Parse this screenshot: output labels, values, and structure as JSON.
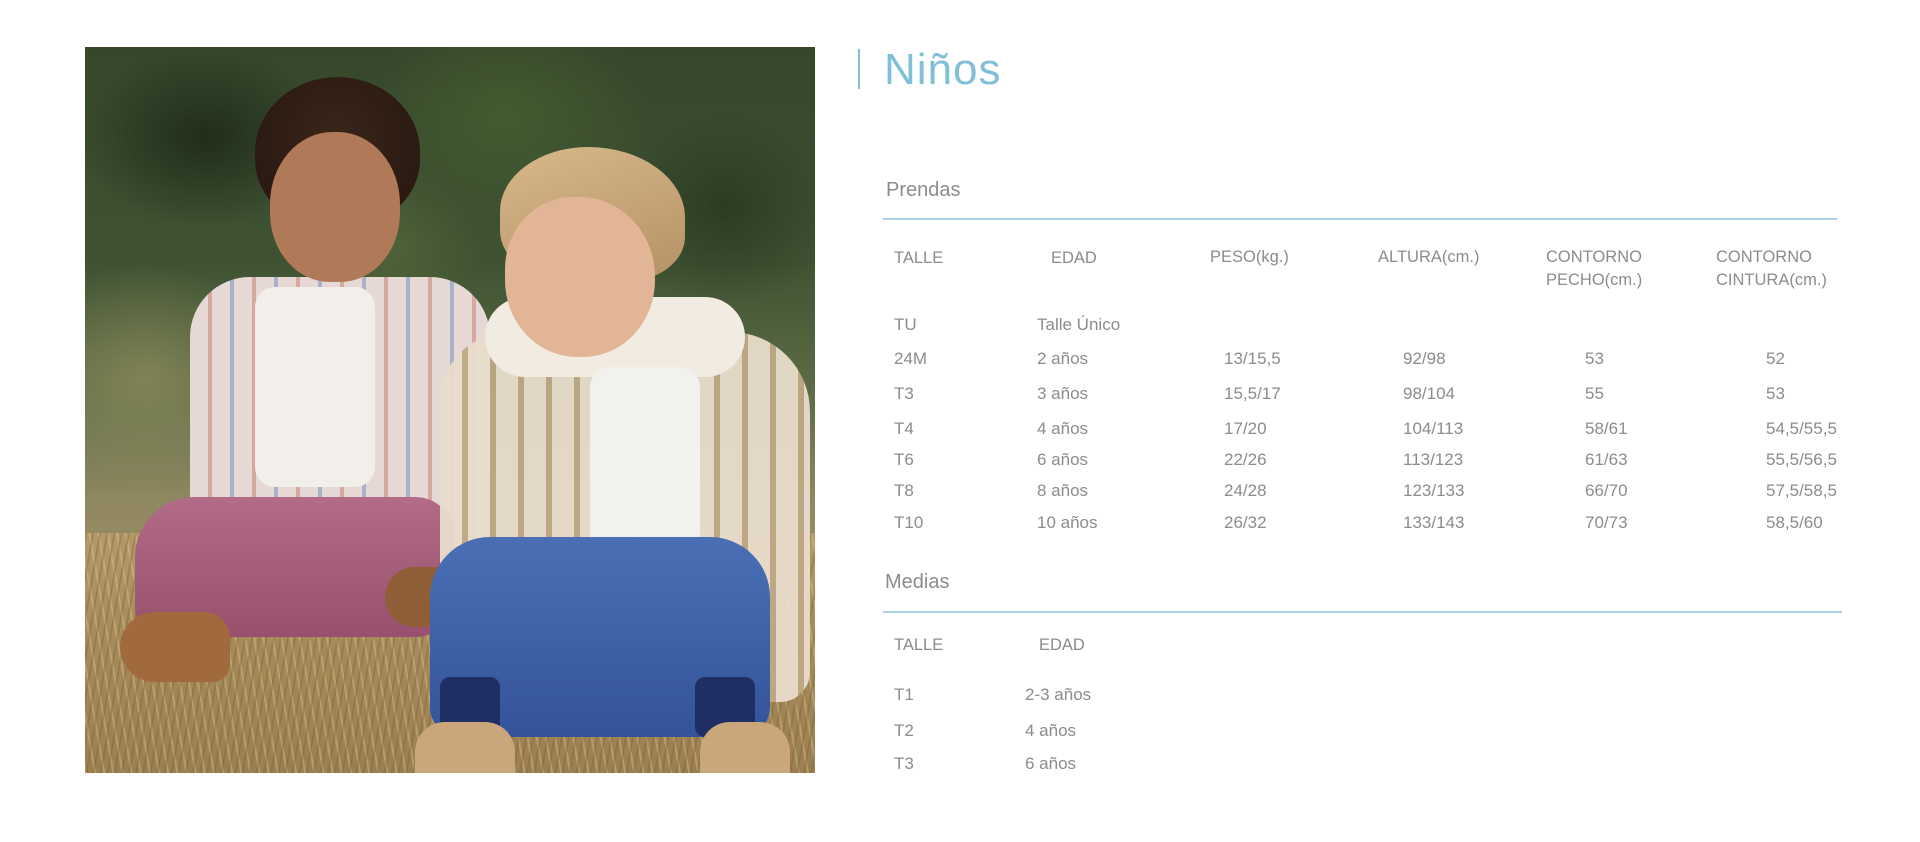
{
  "title": "Niños",
  "prendas": {
    "section_title": "Prendas",
    "headers": [
      "TALLE",
      "EDAD",
      "PESO(kg.)",
      "ALTURA(cm.)",
      "CONTORNO PECHO(cm.)",
      "CONTORNO CINTURA(cm.)"
    ],
    "header_lines": {
      "pecho": [
        "CONTORNO",
        "PECHO(cm.)"
      ],
      "cintura": [
        "CONTORNO",
        "CINTURA(cm.)"
      ]
    },
    "rows": [
      [
        "TU",
        "Talle Único",
        "",
        "",
        "",
        ""
      ],
      [
        "24M",
        "2 años",
        "13/15,5",
        "92/98",
        "53",
        "52"
      ],
      [
        "T3",
        "3 años",
        "15,5/17",
        "98/104",
        "55",
        "53"
      ],
      [
        "T4",
        "4 años",
        "17/20",
        "104/113",
        "58/61",
        "54,5/55,5"
      ],
      [
        "T6",
        "6 años",
        "22/26",
        "113/123",
        "61/63",
        "55,5/56,5"
      ],
      [
        "T8",
        "8 años",
        "24/28",
        "123/133",
        "66/70",
        "57,5/58,5"
      ],
      [
        "T10",
        "10 años",
        "26/32",
        "133/143",
        "70/73",
        "58,5/60"
      ]
    ]
  },
  "medias": {
    "section_title": "Medias",
    "headers": [
      "TALLE",
      "EDAD"
    ],
    "rows": [
      [
        "T1",
        "2-3 años"
      ],
      [
        "T2",
        "4 años"
      ],
      [
        "T3",
        "6 años"
      ]
    ]
  },
  "colors": {
    "accent": "#7fbfd8",
    "rule": "#a9d3e4",
    "text": "#8c8c8c",
    "background": "#ffffff"
  }
}
